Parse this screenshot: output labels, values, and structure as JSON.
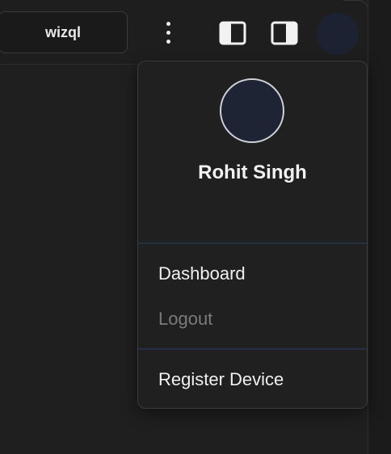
{
  "header": {
    "workspace_label": "wizql",
    "icons": {
      "menu": "more-vertical-icon",
      "left_panel": "left-panel-toggle-icon",
      "right_panel": "right-panel-toggle-icon",
      "avatar": "user-avatar"
    }
  },
  "user_menu": {
    "name": "Rohit Singh",
    "items": [
      {
        "label": "Dashboard",
        "state": "enabled"
      },
      {
        "label": "Logout",
        "state": "disabled"
      },
      {
        "label": "Register Device",
        "state": "enabled"
      }
    ]
  },
  "colors": {
    "background": "#1f1f1f",
    "menu_text": "#f0f0f0",
    "disabled_text": "#7b7b7b",
    "divider": "#25303f",
    "avatar_fill": "#1e2433"
  }
}
